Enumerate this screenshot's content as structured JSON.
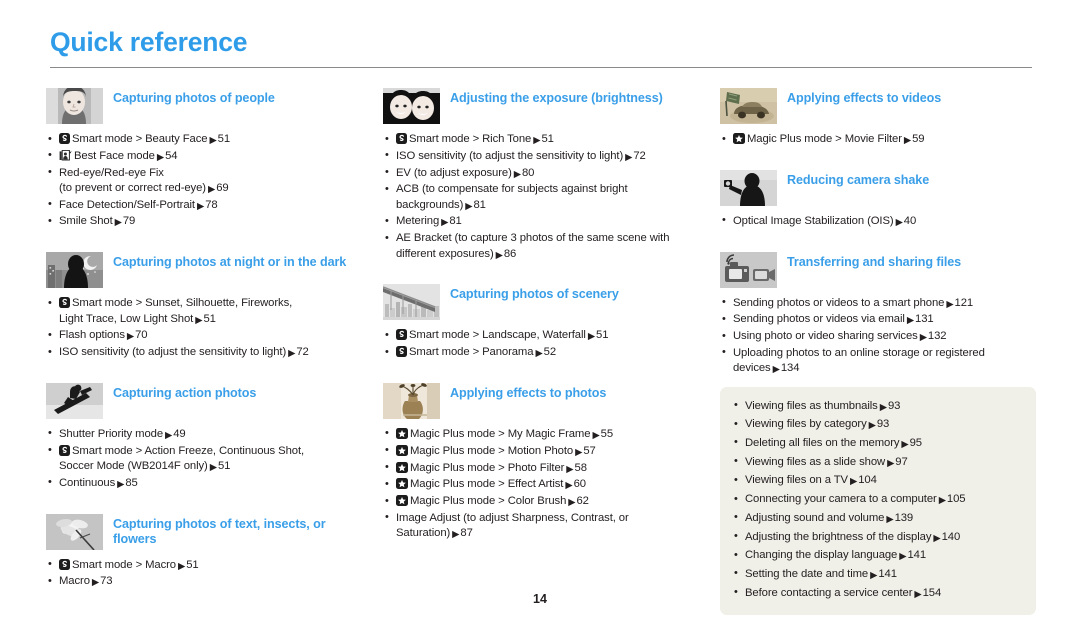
{
  "page": {
    "title": "Quick reference",
    "folio": "14",
    "accent_color": "#3a9fe8",
    "text_color": "#231f20",
    "callout_bg": "#f0efe8",
    "arrow_glyph": "▶"
  },
  "columns": [
    {
      "id": "column-1",
      "sections": [
        {
          "id": "capturing-photos-of-people",
          "thumb_icon": "portrait-photo-thumbnail",
          "title": "Capturing photos of people",
          "items": [
            {
              "icon": "smart-mode-icon",
              "text": "Smart mode > Beauty Face",
              "arrow": "▶",
              "page": "51"
            },
            {
              "icon": "best-face-mode-icon",
              "text": "Best Face mode",
              "arrow": "▶",
              "page": "54"
            },
            {
              "icon": null,
              "text": "Red-eye/Red-eye Fix\n(to prevent or correct red-eye)",
              "arrow": "▶",
              "page": "69"
            },
            {
              "icon": null,
              "text": "Face Detection/Self-Portrait",
              "arrow": "▶",
              "page": "78"
            },
            {
              "icon": null,
              "text": "Smile Shot",
              "arrow": "▶",
              "page": "79"
            }
          ]
        },
        {
          "id": "capturing-photos-at-night-or-in-the-dark",
          "thumb_icon": "night-scene-thumbnail",
          "title": "Capturing photos at night or in the dark",
          "items": [
            {
              "icon": "smart-mode-icon",
              "text": "Smart mode > Sunset, Silhouette, Fireworks,\nLight Trace, Low Light Shot",
              "arrow": "▶",
              "page": "51"
            },
            {
              "icon": null,
              "text": "Flash options",
              "arrow": "▶",
              "page": "70"
            },
            {
              "icon": null,
              "text": "ISO sensitivity (to adjust the sensitivity to light)",
              "arrow": "▶",
              "page": "72"
            }
          ]
        },
        {
          "id": "capturing-action-photos",
          "thumb_icon": "snowboarder-thumbnail",
          "title": "Capturing action photos",
          "items": [
            {
              "icon": null,
              "text": "Shutter Priority mode",
              "arrow": "▶",
              "page": "49"
            },
            {
              "icon": "smart-mode-icon",
              "text": "Smart mode > Action Freeze, Continuous Shot,\nSoccer Mode (WB2014F only)",
              "arrow": "▶",
              "page": "51"
            },
            {
              "icon": null,
              "text": "Continuous",
              "arrow": "▶",
              "page": "85"
            }
          ]
        },
        {
          "id": "capturing-photos-of-text-insects-or-flowers",
          "thumb_icon": "flower-macro-thumbnail",
          "title": "Capturing photos of text, insects, or flowers",
          "items": [
            {
              "icon": "smart-mode-icon",
              "text": "Smart mode > Macro",
              "arrow": "▶",
              "page": "51"
            },
            {
              "icon": null,
              "text": "Macro",
              "arrow": "▶",
              "page": "73"
            }
          ]
        }
      ]
    },
    {
      "id": "column-2",
      "sections": [
        {
          "id": "adjusting-the-exposure-brightness",
          "thumb_icon": "two-faces-thumbnail",
          "title": "Adjusting the exposure (brightness)",
          "items": [
            {
              "icon": "smart-mode-icon",
              "text": "Smart mode > Rich Tone",
              "arrow": "▶",
              "page": "51"
            },
            {
              "icon": null,
              "text": "ISO sensitivity (to adjust the sensitivity to light)",
              "arrow": "▶",
              "page": "72"
            },
            {
              "icon": null,
              "text": "EV (to adjust exposure)",
              "arrow": "▶",
              "page": "80"
            },
            {
              "icon": null,
              "text": "ACB (to compensate for subjects against bright\nbackgrounds)",
              "arrow": "▶",
              "page": "81"
            },
            {
              "icon": null,
              "text": "Metering",
              "arrow": "▶",
              "page": "81"
            },
            {
              "icon": null,
              "text": "AE Bracket (to capture 3 photos of the same scene with\ndifferent exposures)",
              "arrow": "▶",
              "page": "86"
            }
          ]
        },
        {
          "id": "capturing-photos-of-scenery",
          "thumb_icon": "bridge-skyline-thumbnail",
          "title": "Capturing photos of scenery",
          "items": [
            {
              "icon": "smart-mode-icon",
              "text": "Smart mode > Landscape, Waterfall",
              "arrow": "▶",
              "page": "51"
            },
            {
              "icon": "smart-mode-icon",
              "text": "Smart mode > Panorama",
              "arrow": "▶",
              "page": "52"
            }
          ]
        },
        {
          "id": "applying-effects-to-photos",
          "thumb_icon": "vase-still-life-thumbnail",
          "title": "Applying effects to photos",
          "items": [
            {
              "icon": "magic-plus-icon",
              "text": "Magic Plus mode > My Magic Frame",
              "arrow": "▶",
              "page": "55"
            },
            {
              "icon": "magic-plus-icon",
              "text": "Magic Plus mode > Motion Photo",
              "arrow": "▶",
              "page": "57"
            },
            {
              "icon": "magic-plus-icon",
              "text": "Magic Plus mode > Photo Filter",
              "arrow": "▶",
              "page": "58"
            },
            {
              "icon": "magic-plus-icon",
              "text": "Magic Plus mode > Effect Artist",
              "arrow": "▶",
              "page": "60"
            },
            {
              "icon": "magic-plus-icon",
              "text": "Magic Plus mode > Color Brush",
              "arrow": "▶",
              "page": "62"
            },
            {
              "icon": null,
              "text": "Image Adjust (to adjust Sharpness, Contrast, or\nSaturation)",
              "arrow": "▶",
              "page": "87"
            }
          ]
        }
      ]
    },
    {
      "id": "column-3",
      "sections": [
        {
          "id": "applying-effects-to-videos",
          "thumb_icon": "toy-car-video-thumbnail",
          "title": "Applying effects to videos",
          "items": [
            {
              "icon": "magic-plus-icon",
              "text": "Magic Plus mode > Movie Filter",
              "arrow": "▶",
              "page": "59"
            }
          ]
        },
        {
          "id": "reducing-camera-shake",
          "thumb_icon": "camera-shake-thumbnail",
          "title": "Reducing camera shake",
          "items": [
            {
              "icon": null,
              "text": "Optical Image Stabilization (OIS)",
              "arrow": "▶",
              "page": "40"
            }
          ]
        },
        {
          "id": "transferring-and-sharing-files",
          "thumb_icon": "wifi-camera-transfer-thumbnail",
          "title": "Transferring and sharing files",
          "items": [
            {
              "icon": null,
              "text": "Sending photos or videos to a smart phone",
              "arrow": "▶",
              "page": "121"
            },
            {
              "icon": null,
              "text": "Sending photos or videos via email",
              "arrow": "▶",
              "page": "131"
            },
            {
              "icon": null,
              "text": "Using photo or video sharing services",
              "arrow": "▶",
              "page": "132"
            },
            {
              "icon": null,
              "text": "Uploading photos to an online storage or registered\ndevices",
              "arrow": "▶",
              "page": "134"
            }
          ]
        }
      ],
      "callout": {
        "id": "general-tasks-callout",
        "items": [
          {
            "text": "Viewing files as thumbnails",
            "arrow": "▶",
            "page": "93"
          },
          {
            "text": "Viewing files by category",
            "arrow": "▶",
            "page": "93"
          },
          {
            "text": "Deleting all files on the memory",
            "arrow": "▶",
            "page": "95"
          },
          {
            "text": "Viewing files as a slide show",
            "arrow": "▶",
            "page": "97"
          },
          {
            "text": "Viewing files on a TV",
            "arrow": "▶",
            "page": "104"
          },
          {
            "text": "Connecting your camera to a computer",
            "arrow": "▶",
            "page": "105"
          },
          {
            "text": "Adjusting sound and volume",
            "arrow": "▶",
            "page": "139"
          },
          {
            "text": "Adjusting the brightness of the display",
            "arrow": "▶",
            "page": "140"
          },
          {
            "text": "Changing the display language",
            "arrow": "▶",
            "page": "141"
          },
          {
            "text": "Setting the date and time",
            "arrow": "▶",
            "page": "141"
          },
          {
            "text": "Before contacting a service center",
            "arrow": "▶",
            "page": "154"
          }
        ]
      }
    }
  ]
}
